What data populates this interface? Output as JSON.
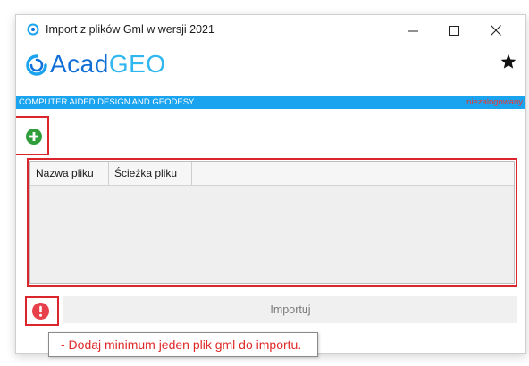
{
  "window": {
    "title": "Import z plików Gml w wersji 2021",
    "minimize_glyph": "—",
    "maximize_glyph": "☐",
    "close_glyph": "✕"
  },
  "header": {
    "logo_part1": "Acad",
    "logo_part2": "GEO",
    "tagline": "COMPUTER AIDED DESIGN AND GEODESY",
    "login_status": "niezalogowany",
    "favorite_icon": "star-icon"
  },
  "toolbar": {
    "add_icon": "plus-circle-icon"
  },
  "file_grid": {
    "columns": [
      "Nazwa pliku",
      "Ścieżka pliku"
    ],
    "rows": []
  },
  "footer": {
    "error_icon": "exclamation-circle-icon",
    "import_label": "Importuj"
  },
  "tooltip": {
    "message": "- Dodaj minimum jeden plik gml do importu."
  },
  "colors": {
    "accent_blue": "#1aa3ef",
    "logo_blue": "#0f6fd7",
    "error_red": "#d9252b",
    "add_green": "#2e9d3a"
  }
}
